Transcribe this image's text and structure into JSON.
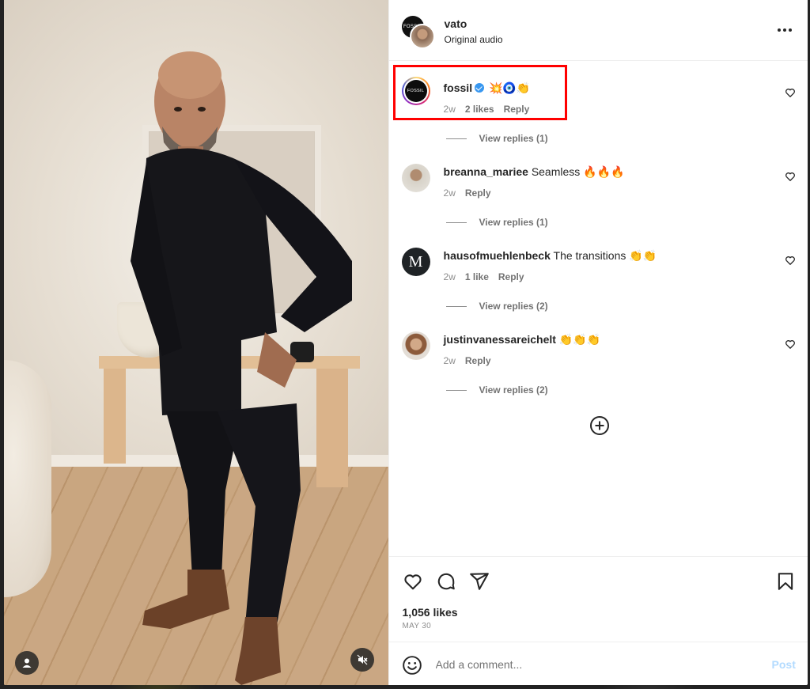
{
  "post": {
    "username": "vato",
    "audio": "Original audio",
    "header_avatar_text": "FOSSIL"
  },
  "comments": [
    {
      "username": "fossil",
      "avatar_text": "FOSSIL",
      "verified": true,
      "text": "💥🧿👏",
      "time": "2w",
      "likes": "2 likes",
      "reply_label": "Reply",
      "view_replies": "View replies (1)"
    },
    {
      "username": "breanna_mariee",
      "text": "Seamless 🔥🔥🔥",
      "time": "2w",
      "reply_label": "Reply",
      "view_replies": "View replies (1)"
    },
    {
      "username": "hausofmuehlenbeck",
      "avatar_text": "M",
      "text": "The transitions 👏👏",
      "time": "2w",
      "likes": "1 like",
      "reply_label": "Reply",
      "view_replies": "View replies (2)"
    },
    {
      "username": "justinvanessareichelt",
      "text": "👏👏👏",
      "time": "2w",
      "reply_label": "Reply",
      "view_replies": "View replies (2)"
    }
  ],
  "stats": {
    "likes": "1,056 likes",
    "date": "MAY 30"
  },
  "composer": {
    "placeholder": "Add a comment...",
    "post_label": "Post"
  },
  "icons": {
    "like": "heart-icon",
    "comment": "comment-icon",
    "share": "share-icon",
    "save": "bookmark-icon",
    "more": "more-icon",
    "load_more": "plus-circle-icon",
    "emoji": "emoji-icon",
    "mute": "mute-icon",
    "tagged": "person-icon"
  },
  "colors": {
    "highlight": "#ff0000",
    "verified": "#3897f0",
    "post_disabled": "#b3dbff"
  }
}
